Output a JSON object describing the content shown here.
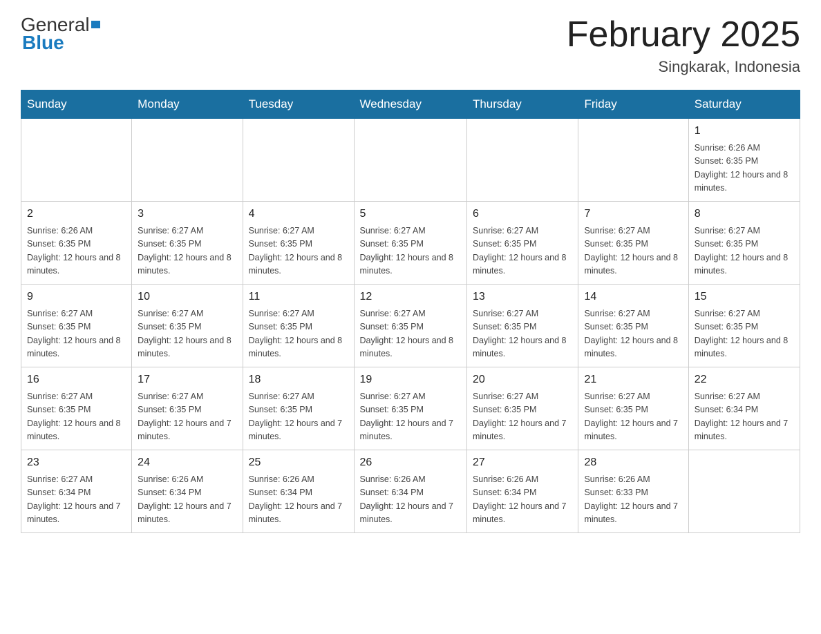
{
  "logo": {
    "text_general": "General",
    "text_blue": "Blue"
  },
  "header": {
    "month_year": "February 2025",
    "location": "Singkarak, Indonesia"
  },
  "days_of_week": [
    "Sunday",
    "Monday",
    "Tuesday",
    "Wednesday",
    "Thursday",
    "Friday",
    "Saturday"
  ],
  "weeks": [
    [
      {
        "day": "",
        "info": ""
      },
      {
        "day": "",
        "info": ""
      },
      {
        "day": "",
        "info": ""
      },
      {
        "day": "",
        "info": ""
      },
      {
        "day": "",
        "info": ""
      },
      {
        "day": "",
        "info": ""
      },
      {
        "day": "1",
        "info": "Sunrise: 6:26 AM\nSunset: 6:35 PM\nDaylight: 12 hours and 8 minutes."
      }
    ],
    [
      {
        "day": "2",
        "info": "Sunrise: 6:26 AM\nSunset: 6:35 PM\nDaylight: 12 hours and 8 minutes."
      },
      {
        "day": "3",
        "info": "Sunrise: 6:27 AM\nSunset: 6:35 PM\nDaylight: 12 hours and 8 minutes."
      },
      {
        "day": "4",
        "info": "Sunrise: 6:27 AM\nSunset: 6:35 PM\nDaylight: 12 hours and 8 minutes."
      },
      {
        "day": "5",
        "info": "Sunrise: 6:27 AM\nSunset: 6:35 PM\nDaylight: 12 hours and 8 minutes."
      },
      {
        "day": "6",
        "info": "Sunrise: 6:27 AM\nSunset: 6:35 PM\nDaylight: 12 hours and 8 minutes."
      },
      {
        "day": "7",
        "info": "Sunrise: 6:27 AM\nSunset: 6:35 PM\nDaylight: 12 hours and 8 minutes."
      },
      {
        "day": "8",
        "info": "Sunrise: 6:27 AM\nSunset: 6:35 PM\nDaylight: 12 hours and 8 minutes."
      }
    ],
    [
      {
        "day": "9",
        "info": "Sunrise: 6:27 AM\nSunset: 6:35 PM\nDaylight: 12 hours and 8 minutes."
      },
      {
        "day": "10",
        "info": "Sunrise: 6:27 AM\nSunset: 6:35 PM\nDaylight: 12 hours and 8 minutes."
      },
      {
        "day": "11",
        "info": "Sunrise: 6:27 AM\nSunset: 6:35 PM\nDaylight: 12 hours and 8 minutes."
      },
      {
        "day": "12",
        "info": "Sunrise: 6:27 AM\nSunset: 6:35 PM\nDaylight: 12 hours and 8 minutes."
      },
      {
        "day": "13",
        "info": "Sunrise: 6:27 AM\nSunset: 6:35 PM\nDaylight: 12 hours and 8 minutes."
      },
      {
        "day": "14",
        "info": "Sunrise: 6:27 AM\nSunset: 6:35 PM\nDaylight: 12 hours and 8 minutes."
      },
      {
        "day": "15",
        "info": "Sunrise: 6:27 AM\nSunset: 6:35 PM\nDaylight: 12 hours and 8 minutes."
      }
    ],
    [
      {
        "day": "16",
        "info": "Sunrise: 6:27 AM\nSunset: 6:35 PM\nDaylight: 12 hours and 8 minutes."
      },
      {
        "day": "17",
        "info": "Sunrise: 6:27 AM\nSunset: 6:35 PM\nDaylight: 12 hours and 7 minutes."
      },
      {
        "day": "18",
        "info": "Sunrise: 6:27 AM\nSunset: 6:35 PM\nDaylight: 12 hours and 7 minutes."
      },
      {
        "day": "19",
        "info": "Sunrise: 6:27 AM\nSunset: 6:35 PM\nDaylight: 12 hours and 7 minutes."
      },
      {
        "day": "20",
        "info": "Sunrise: 6:27 AM\nSunset: 6:35 PM\nDaylight: 12 hours and 7 minutes."
      },
      {
        "day": "21",
        "info": "Sunrise: 6:27 AM\nSunset: 6:35 PM\nDaylight: 12 hours and 7 minutes."
      },
      {
        "day": "22",
        "info": "Sunrise: 6:27 AM\nSunset: 6:34 PM\nDaylight: 12 hours and 7 minutes."
      }
    ],
    [
      {
        "day": "23",
        "info": "Sunrise: 6:27 AM\nSunset: 6:34 PM\nDaylight: 12 hours and 7 minutes."
      },
      {
        "day": "24",
        "info": "Sunrise: 6:26 AM\nSunset: 6:34 PM\nDaylight: 12 hours and 7 minutes."
      },
      {
        "day": "25",
        "info": "Sunrise: 6:26 AM\nSunset: 6:34 PM\nDaylight: 12 hours and 7 minutes."
      },
      {
        "day": "26",
        "info": "Sunrise: 6:26 AM\nSunset: 6:34 PM\nDaylight: 12 hours and 7 minutes."
      },
      {
        "day": "27",
        "info": "Sunrise: 6:26 AM\nSunset: 6:34 PM\nDaylight: 12 hours and 7 minutes."
      },
      {
        "day": "28",
        "info": "Sunrise: 6:26 AM\nSunset: 6:33 PM\nDaylight: 12 hours and 7 minutes."
      },
      {
        "day": "",
        "info": ""
      }
    ]
  ]
}
